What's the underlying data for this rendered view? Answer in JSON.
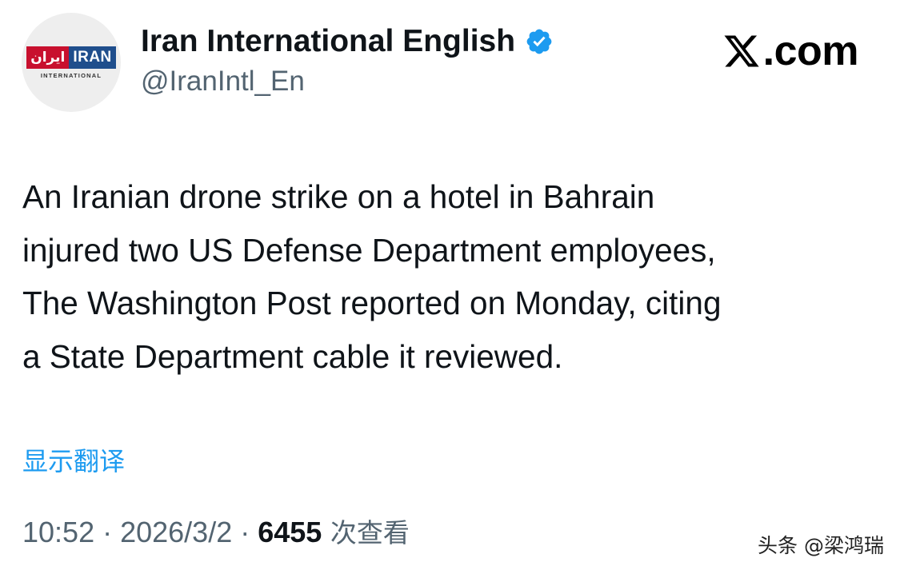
{
  "account": {
    "logo_fa": "ایران",
    "logo_en": "IRAN",
    "logo_sub": "INTERNATIONAL",
    "name": "Iran International English",
    "handle": "@IranIntl_En",
    "verified_color": "#1d9bf0"
  },
  "source": {
    "x_glyph": "x-logo-icon",
    "domain": ".com"
  },
  "tweet": {
    "lines": [
      "An Iranian drone strike on a hotel in Bahrain",
      "injured two US Defense Department employees,",
      "The Washington Post reported on Monday, citing",
      "a State Department cable it reviewed."
    ]
  },
  "translate_label": "显示翻译",
  "meta": {
    "time": "10:52",
    "sep1": " · ",
    "date": "2026/3/2",
    "sep2": " · ",
    "views": "6455",
    "views_label": " 次查看"
  },
  "watermark": "头条 @梁鸿瑞"
}
